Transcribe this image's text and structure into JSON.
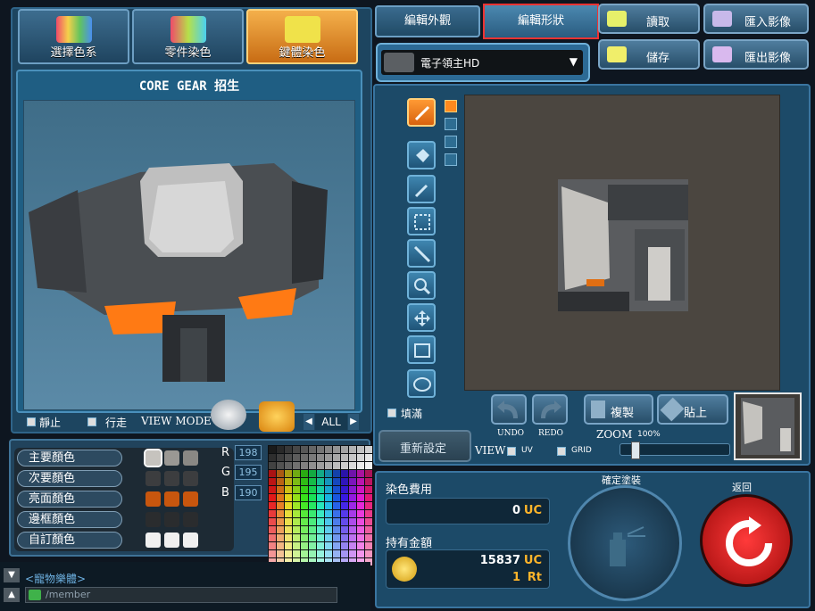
{
  "tabs": [
    {
      "label": "選擇色系",
      "icon": "palette-icon"
    },
    {
      "label": "零件染色",
      "icon": "parts-icon"
    },
    {
      "label": "鍵體染色",
      "icon": "paint-icon"
    }
  ],
  "preview": {
    "title": "CORE GEAR 招生"
  },
  "view_mode": {
    "still_label": "靜止",
    "walk_label": "行走",
    "mode_label": "VIEW MODE",
    "all_label": "ALL"
  },
  "color_rows": [
    "主要顏色",
    "次要顏色",
    "亮面顏色",
    "邊框顏色",
    "自訂顏色"
  ],
  "rgb": {
    "r_label": "R",
    "g_label": "G",
    "b_label": "B",
    "r": "198",
    "g": "195",
    "b": "190"
  },
  "edit_tabs": {
    "appearance": "編輯外觀",
    "shape": "編輯形狀"
  },
  "file_buttons": {
    "load": "讀取",
    "import": "匯入影像",
    "save": "儲存",
    "export": "匯出影像"
  },
  "model_select": {
    "value": "電子領主HD"
  },
  "canvas_controls": {
    "fill_label": "填滿",
    "undo_label": "UNDO",
    "redo_label": "REDO",
    "copy_label": "複製",
    "paste_label": "貼上",
    "reset_label": "重新設定",
    "view_label": "VIEW",
    "uv_label": "UV",
    "grid_label": "GRID",
    "zoom_label": "ZOOM",
    "zoom_value": "100%"
  },
  "cost": {
    "dye_cost_label": "染色費用",
    "dye_cost_value": "0",
    "dye_cost_unit": "UC",
    "balance_label": "持有金額",
    "balance_uc": "15837",
    "balance_uc_unit": "UC",
    "balance_rt": "1",
    "balance_rt_unit": "Rt",
    "confirm_label": "確定塗裝",
    "back_label": "返回"
  },
  "chat": {
    "line1": "<寵物樂體>",
    "line2": "/member"
  }
}
